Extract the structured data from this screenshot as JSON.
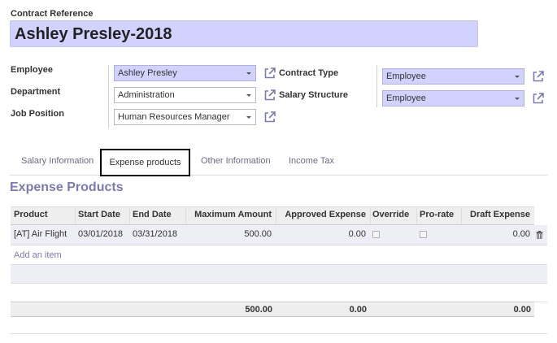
{
  "contract": {
    "reference_label": "Contract Reference",
    "reference_value": "Ashley Presley-2018"
  },
  "left_fields": {
    "employee_label": "Employee",
    "employee_value": "Ashley Presley",
    "department_label": "Department",
    "department_value": "Administration",
    "job_position_label": "Job Position",
    "job_position_value": "Human Resources Manager"
  },
  "right_fields": {
    "contract_type_label": "Contract Type",
    "contract_type_value": "Employee",
    "salary_structure_label": "Salary Structure",
    "salary_structure_value": "Employee"
  },
  "tabs": [
    {
      "label": "Salary Information",
      "active": false
    },
    {
      "label": "Expense products",
      "active": true
    },
    {
      "label": "Other Information",
      "active": false
    },
    {
      "label": "Income Tax",
      "active": false
    }
  ],
  "section_title": "Expense Products",
  "table": {
    "columns": [
      "Product",
      "Start Date",
      "End Date",
      "Maximum Amount",
      "Approved Expense",
      "Override",
      "Pro-rate",
      "Draft Expense"
    ],
    "rows": [
      {
        "product": "[AT] Air Flight",
        "start_date": "03/01/2018",
        "end_date": "03/31/2018",
        "maximum_amount": "500.00",
        "approved_expense": "0.00",
        "override": false,
        "pro_rate": false,
        "draft_expense": "0.00"
      }
    ],
    "add_item_label": "Add an item",
    "totals": {
      "maximum_amount": "500.00",
      "approved_expense": "0.00",
      "draft_expense": "0.00"
    }
  },
  "colors": {
    "required_field": "#d2d2ff",
    "accent": "#7c7bad"
  },
  "icons": [
    "external-link-icon",
    "trash-icon",
    "caret-down-icon"
  ]
}
